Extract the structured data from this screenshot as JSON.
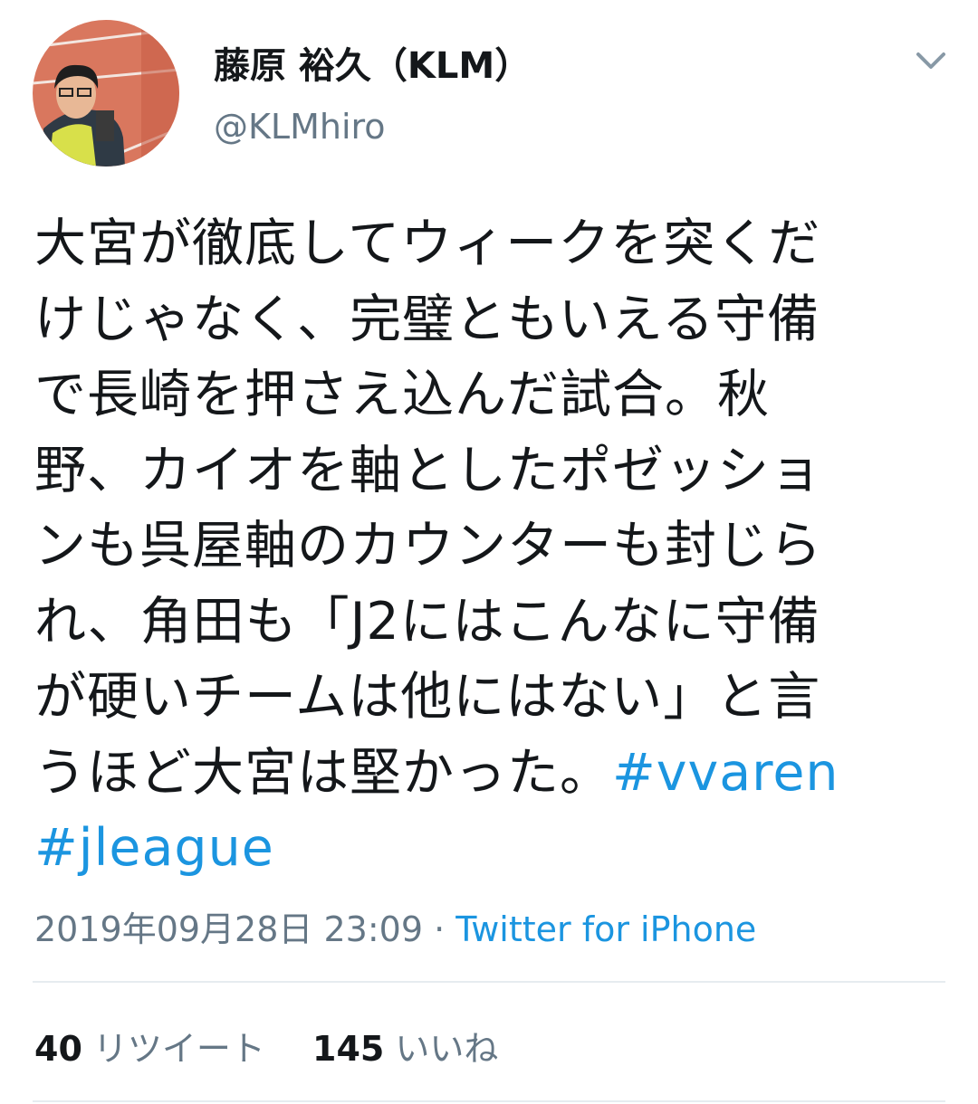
{
  "author": {
    "display_name": "藤原 裕久（KLM）",
    "handle": "@KLMhiro"
  },
  "menu_icon": "chevron-down-icon",
  "tweet": {
    "lines": [
      "大宮が徹底してウィークを突くだ",
      "けじゃなく、完璧ともいえる守備",
      "で長崎を押さえ込んだ試合。秋",
      "野、カイオを軸としたポゼッショ",
      "ンも呉屋軸のカウンターも封じら",
      "れ、角田も「J2にはこんなに守備",
      "が硬いチームは他にはない」と言",
      "うほど大宮は堅かった。"
    ],
    "hashtags": [
      "#vvaren",
      "#jleague"
    ]
  },
  "meta": {
    "timestamp": "2019年09月28日 23:09",
    "separator": " · ",
    "source": "Twitter for iPhone"
  },
  "stats": {
    "retweet_count": "40",
    "retweet_label": "リツイート",
    "like_count": "145",
    "like_label": "いいね"
  },
  "colors": {
    "text": "#14171a",
    "secondary": "#657786",
    "link": "#1b95e0",
    "divider": "#e6ecf0"
  }
}
